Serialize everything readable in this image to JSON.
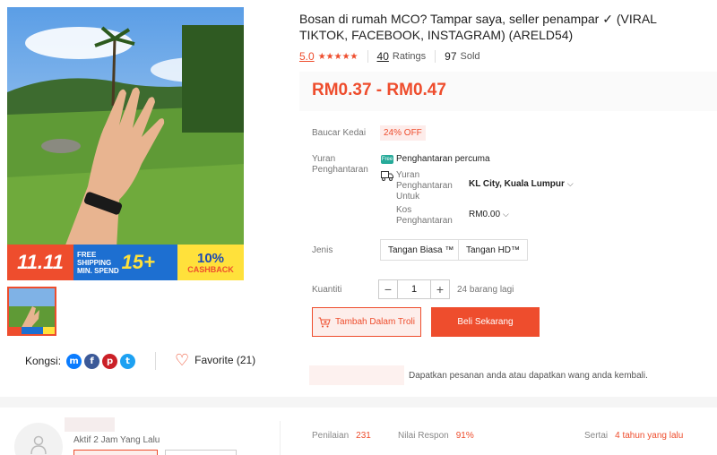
{
  "product": {
    "title": "Bosan di rumah MCO? Tampar saya, seller penampar ✓ (VIRAL TIKTOK, FACEBOOK, INSTAGRAM) (ARELD54)",
    "rating": "5.0",
    "stars": "★★★★★",
    "ratings_count": "40",
    "ratings_label": "Ratings",
    "sold_count": "97",
    "sold_label": "Sold",
    "price": "RM0.37 - RM0.47"
  },
  "promo": {
    "sale": "11.11",
    "free_line1": "FREE",
    "free_line2": "SHIPPING",
    "free_line3": "MIN. SPEND",
    "free_amount": "15+",
    "cashback_pct": "10%",
    "cashback_label": "CASHBACK"
  },
  "details": {
    "voucher_label": "Baucar Kedai",
    "voucher_value": "24% OFF",
    "shipping_label": "Yuran Penghantaran",
    "free_icon": "Free",
    "free_shipping": "Penghantaran percuma",
    "ship_to_label": "Yuran Penghantaran Untuk",
    "ship_to_value": "KL City, Kuala Lumpur",
    "cost_label": "Kos Penghantaran",
    "cost_value": "RM0.00",
    "variant_label": "Jenis",
    "variants": [
      "Tangan Biasa ™",
      "Tangan HD™"
    ],
    "qty_label": "Kuantiti",
    "qty_minus": "−",
    "qty_value": "1",
    "qty_plus": "+",
    "stock": "24 barang lagi"
  },
  "actions": {
    "add_to_cart": "Tambah Dalam Troli",
    "buy_now": "Beli Sekarang"
  },
  "guarantee": "Dapatkan pesanan anda atau dapatkan wang anda kembali.",
  "share": {
    "label": "Kongsi:",
    "favorite": "Favorite (21)"
  },
  "seller": {
    "active": "Aktif 2 Jam Yang Lalu",
    "stats": [
      {
        "label": "Penilaian",
        "value": "231"
      },
      {
        "label": "Nilai Respon",
        "value": "91%"
      },
      {
        "label": "Sertai",
        "value": "4 tahun yang lalu"
      }
    ]
  },
  "colors": {
    "accent": "#ee4d2d",
    "teal": "#26aa99"
  }
}
